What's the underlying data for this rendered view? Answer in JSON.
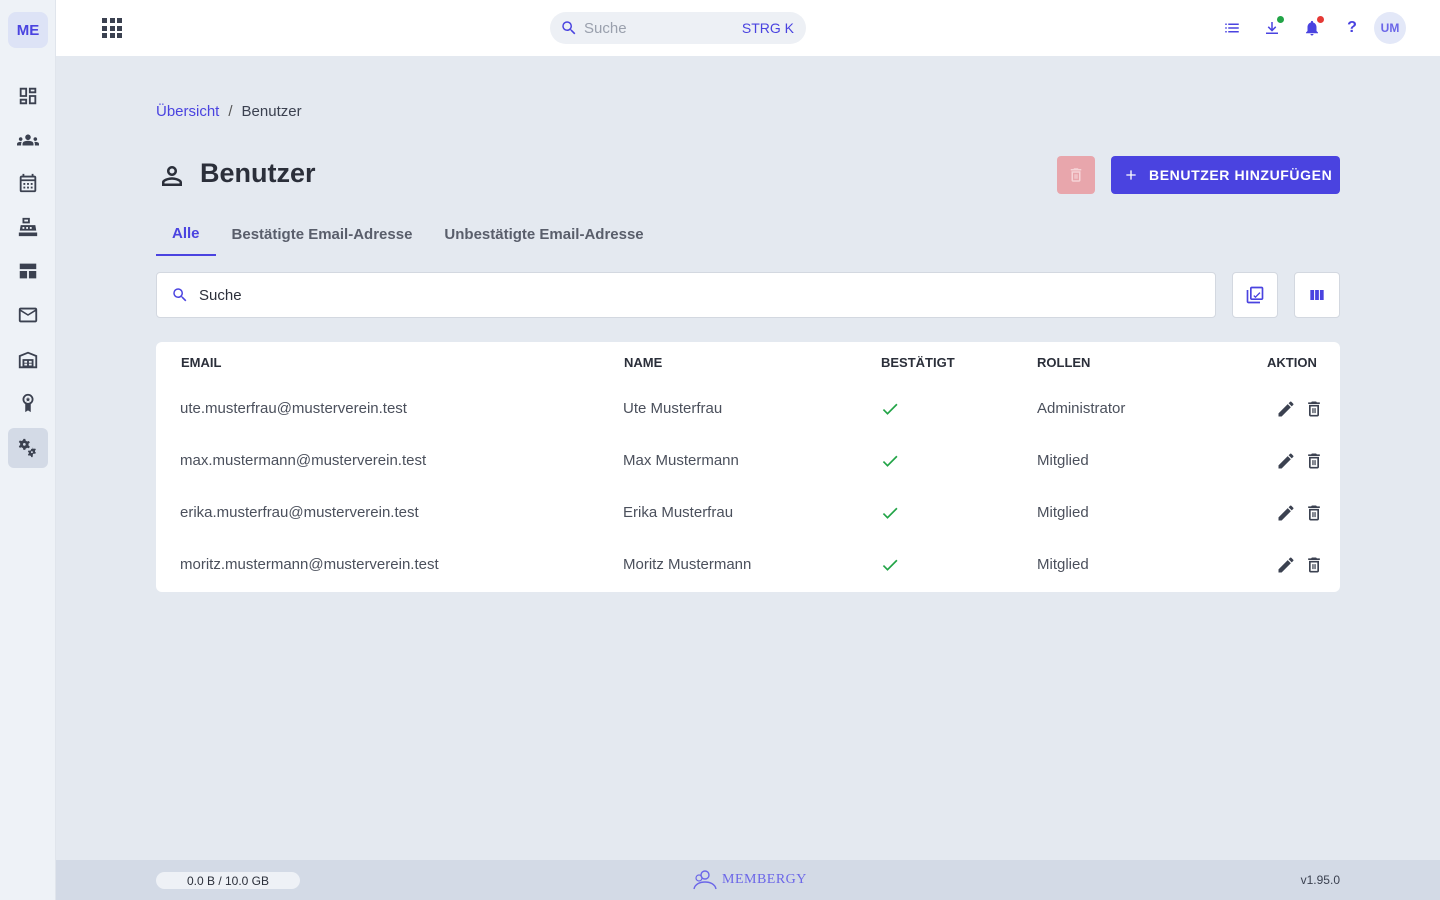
{
  "app": {
    "logo": "ME",
    "avatar": "UM"
  },
  "topbar": {
    "search_placeholder": "Suche",
    "search_shortcut": "STRG K",
    "icons": [
      "apps-icon",
      "list-icon",
      "download-icon",
      "bell-icon",
      "help-icon"
    ],
    "help_label": "?"
  },
  "sidebar": {
    "items": [
      {
        "icon": "dashboard-icon"
      },
      {
        "icon": "members-icon"
      },
      {
        "icon": "calendar-icon"
      },
      {
        "icon": "cashier-icon"
      },
      {
        "icon": "table-icon"
      },
      {
        "icon": "mail-icon"
      },
      {
        "icon": "warehouse-icon"
      },
      {
        "icon": "award-icon"
      },
      {
        "icon": "settings-icon",
        "active": true
      }
    ]
  },
  "breadcrumb": {
    "parent": "Übersicht",
    "separator": "/",
    "current": "Benutzer"
  },
  "page": {
    "title": "Benutzer",
    "add_button": "BENUTZER HINZUFÜGEN"
  },
  "tabs": [
    {
      "label": "Alle",
      "active": true
    },
    {
      "label": "Bestätigte Email-Adresse",
      "active": false
    },
    {
      "label": "Unbestätigte Email-Adresse",
      "active": false
    }
  ],
  "search": {
    "placeholder": "Suche"
  },
  "table": {
    "headers": {
      "email": "EMAIL",
      "name": "NAME",
      "confirmed": "BESTÄTIGT",
      "roles": "ROLLEN",
      "action": "AKTION"
    },
    "rows": [
      {
        "email": "ute.musterfrau@musterverein.test",
        "name": "Ute Musterfrau",
        "confirmed": true,
        "role": "Administrator"
      },
      {
        "email": "max.mustermann@musterverein.test",
        "name": "Max Mustermann",
        "confirmed": true,
        "role": "Mitglied"
      },
      {
        "email": "erika.musterfrau@musterverein.test",
        "name": "Erika Musterfrau",
        "confirmed": true,
        "role": "Mitglied"
      },
      {
        "email": "moritz.mustermann@musterverein.test",
        "name": "Moritz Mustermann",
        "confirmed": true,
        "role": "Mitglied"
      }
    ]
  },
  "footer": {
    "storage": "0.0 B / 10.0 GB",
    "brand": "MEMBERGY",
    "version": "v1.95.0"
  },
  "colors": {
    "accent": "#4a43e0",
    "success": "#22a447",
    "danger_disabled": "#e8a6ac",
    "dot_green": "#22a447",
    "dot_red": "#e53935"
  }
}
